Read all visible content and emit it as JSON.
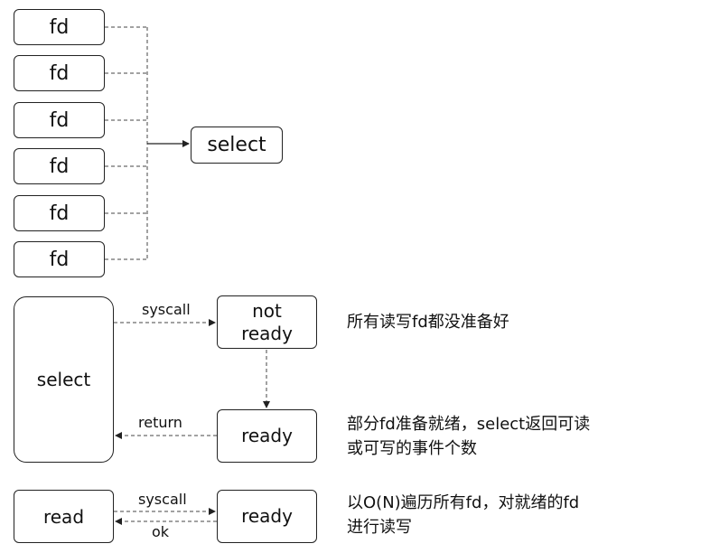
{
  "fd_boxes": [
    "fd",
    "fd",
    "fd",
    "fd",
    "fd",
    "fd"
  ],
  "select_top": "select",
  "select_big": "select",
  "not_ready": [
    "not",
    "ready"
  ],
  "ready_1": "ready",
  "ready_2": "ready",
  "read": "read",
  "edge_labels": {
    "syscall_1": "syscall",
    "return": "return",
    "syscall_2": "syscall",
    "ok": "ok"
  },
  "notes": {
    "not_ready": "所有读写fd都没准备好",
    "partial_ready": [
      "部分fd准备就绪，select返回可读",
      "或可写的事件个数"
    ],
    "traverse": [
      "以O(N)遍历所有fd，对就绪的fd",
      "进行读写"
    ]
  }
}
